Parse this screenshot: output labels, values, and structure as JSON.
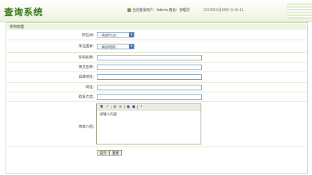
{
  "header": {
    "app_title": "查询系统",
    "user_text": "当前登录用户：Admin 角色：管理员",
    "datetime": "2013年3月28日 9:10:11"
  },
  "section": {
    "title": "机构管理"
  },
  "form": {
    "continent_label": "所在洲：",
    "continent_value": "--请选择大洲--",
    "country_label": "所在国家：",
    "country_value": "--请选择国家--",
    "org_name_label": "机构名称：",
    "english_name_label": "英文名称：",
    "address_label": "具体地址：",
    "website_label": "网址：",
    "contact_label": "联系方式：",
    "intro_label": "简单介绍：",
    "intro_placeholder": "请输入内容"
  },
  "editor_toolbar": {
    "bold": "B",
    "italic": "I",
    "icons": [
      "bold-icon",
      "italic-icon",
      "ordered-list-icon",
      "unordered-list-icon",
      "link-icon",
      "image-icon",
      "help-icon"
    ]
  },
  "buttons": {
    "submit": "提交",
    "reset": "重置"
  },
  "colors": {
    "brand_green": "#2f6f0e",
    "row_bg": "#eef3e2",
    "border": "#cfd8bd"
  }
}
